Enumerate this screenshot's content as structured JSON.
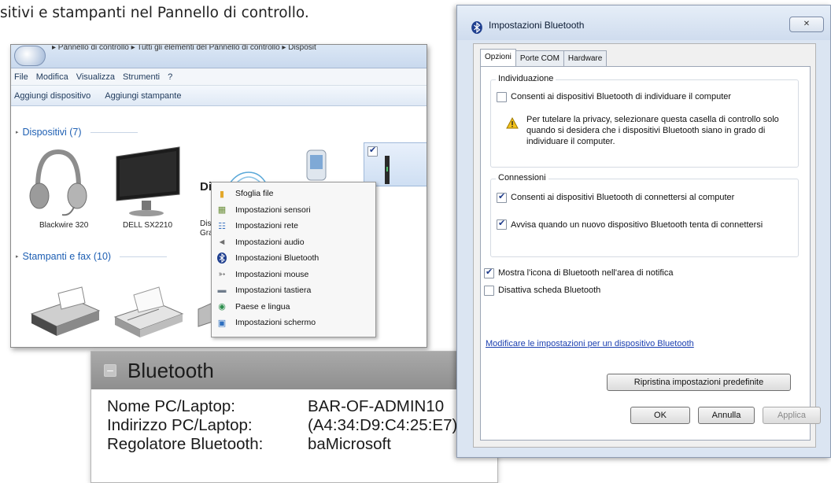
{
  "doc_text": "sitivi e stampanti nel Pannello di controllo.",
  "explorer": {
    "breadcrumbs": "▸ Pannello di controllo ▸ Tutti gli elementi del Pannello di controllo ▸ Disposit",
    "menu": [
      "File",
      "Modifica",
      "Visualizza",
      "Strumenti",
      "?"
    ],
    "toolbar": [
      "Aggiungi dispositivo",
      "Aggiungi stampante"
    ],
    "group_devices": "Dispositivi (7)",
    "group_printers": "Stampanti e fax (10)",
    "devices": [
      {
        "label": "Blackwire 320"
      },
      {
        "label": "DELL SX2210"
      },
      {
        "label": "Dis\nGra"
      }
    ],
    "partial_label": "Di",
    "context_menu": [
      {
        "label": "Sfoglia file",
        "icon": "folder-icon"
      },
      {
        "label": "Impostazioni sensori",
        "icon": "sensor-icon"
      },
      {
        "label": "Impostazioni rete",
        "icon": "network-icon"
      },
      {
        "label": "Impostazioni audio",
        "icon": "speaker-icon"
      },
      {
        "label": "Impostazioni Bluetooth",
        "icon": "bluetooth-icon"
      },
      {
        "label": "Impostazioni mouse",
        "icon": "mouse-icon"
      },
      {
        "label": "Impostazioni tastiera",
        "icon": "keyboard-icon"
      },
      {
        "label": "Paese e lingua",
        "icon": "globe-icon"
      },
      {
        "label": "Impostazioni schermo",
        "icon": "monitor-icon"
      }
    ]
  },
  "bt_panel": {
    "title": "Bluetooth",
    "rows": [
      {
        "label": "Nome PC/Laptop:",
        "value": "BAR-OF-ADMIN10"
      },
      {
        "label": "Indirizzo PC/Laptop:",
        "value": "(A4:34:D9:C4:25:E7)"
      },
      {
        "label": "Regolatore Bluetooth:",
        "value": "baMicrosoft"
      }
    ]
  },
  "dialog": {
    "title": "Impostazioni Bluetooth",
    "tabs": [
      "Opzioni",
      "Porte COM",
      "Hardware"
    ],
    "discovery": {
      "title": "Individuazione",
      "allow_discover": "Consenti ai dispositivi Bluetooth di individuare il computer",
      "warning": "Per tutelare la privacy, selezionare questa casella di controllo solo quando si desidera che i dispositivi Bluetooth siano in grado di individuare il computer."
    },
    "connections": {
      "title": "Connessioni",
      "allow_connect": "Consenti ai dispositivi Bluetooth di connettersi al computer",
      "notify_new": "Avvisa quando un nuovo dispositivo Bluetooth tenta di connettersi"
    },
    "show_icon": "Mostra l'icona di Bluetooth nell'area di notifica",
    "disable_adapter": "Disattiva scheda Bluetooth",
    "change_link": "Modificare le impostazioni per un dispositivo Bluetooth",
    "restore_button": "Ripristina impostazioni predefinite",
    "ok_button": "OK",
    "cancel_button": "Annulla",
    "apply_button": "Applica",
    "checks": {
      "allow_discover": false,
      "allow_connect": true,
      "notify_new": true,
      "show_icon": true,
      "disable_adapter": false
    }
  }
}
